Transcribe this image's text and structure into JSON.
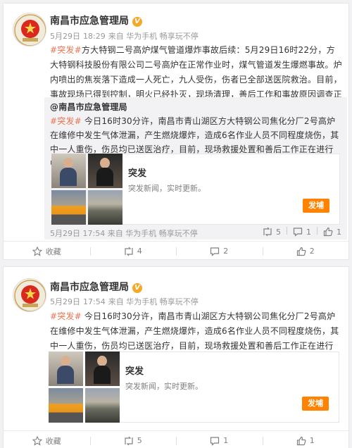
{
  "posts": [
    {
      "account_name": "南昌市应急管理局",
      "date": "5月29日",
      "time": "18:29",
      "source": "来自 华为手机 畅享玩不停",
      "tag": "#突发#",
      "text": "方大特钢二号高炉煤气管道爆炸事故后续：5月29日16时22分，方大特钢科技股份有限公司二号高炉在正常作业时，煤气管道发生爆燃事故。炉内喷出的焦炭落下造成一人死亡，九人受伤，伤者已全部送医院救治。目前，事故现场已得到控制，明火已经扑灭，现场清理，善后工作和事故原因调查正在进行之中。",
      "repost": {
        "author": "@南昌市应急管理局",
        "tag": "#突发#",
        "text": " 今日16时30分许，南昌市青山湖区方大特钢公司焦化分厂2号高炉在维修中发生气体泄漏，产生燃烧爆炸，造成6名作业人员不同程度烧伤，其中一人重伤，伤员均已送医治疗，目前，现场救援处置和善后工作正在进行中。",
        "live_title": "突发",
        "live_sub": "突发新闻，实时更新。",
        "live_button": "发埔",
        "date": "5月29日",
        "time": "17:54",
        "source": "来自 华为手机 畅享玩不停",
        "reposts": "5",
        "comments": "1",
        "likes": "1"
      },
      "actions": {
        "collect": "收藏",
        "reposts": "4",
        "comments": "2",
        "likes": "2"
      }
    },
    {
      "account_name": "南昌市应急管理局",
      "date": "5月29日",
      "time": "17:54",
      "source": "来自 华为手机 畅享玩不停",
      "tag": "#突发#",
      "text": " 今日16时30分许，南昌市青山湖区方大特钢公司焦化分厂2号高炉在维修中发生气体泄漏，产生燃烧爆炸，造成6名作业人员不同程度烧伤，其中一人重伤，伤员均已送医治疗，目前，现场救援处置和善后工作正在进行中。",
      "live_title": "突发",
      "live_sub": "突发新闻，实时更新。",
      "live_button": "发埔",
      "actions": {
        "collect": "收藏",
        "reposts": "5",
        "comments": "1",
        "likes": "1"
      }
    }
  ],
  "colors": {
    "accent": "#ff8200",
    "tag": "#eb7350",
    "verified": "#f3a92a",
    "emblem_red": "#d9281e"
  },
  "icons": [
    "verified-badge-icon",
    "star-icon",
    "repost-icon",
    "comment-icon",
    "like-icon",
    "emblem-icon"
  ]
}
